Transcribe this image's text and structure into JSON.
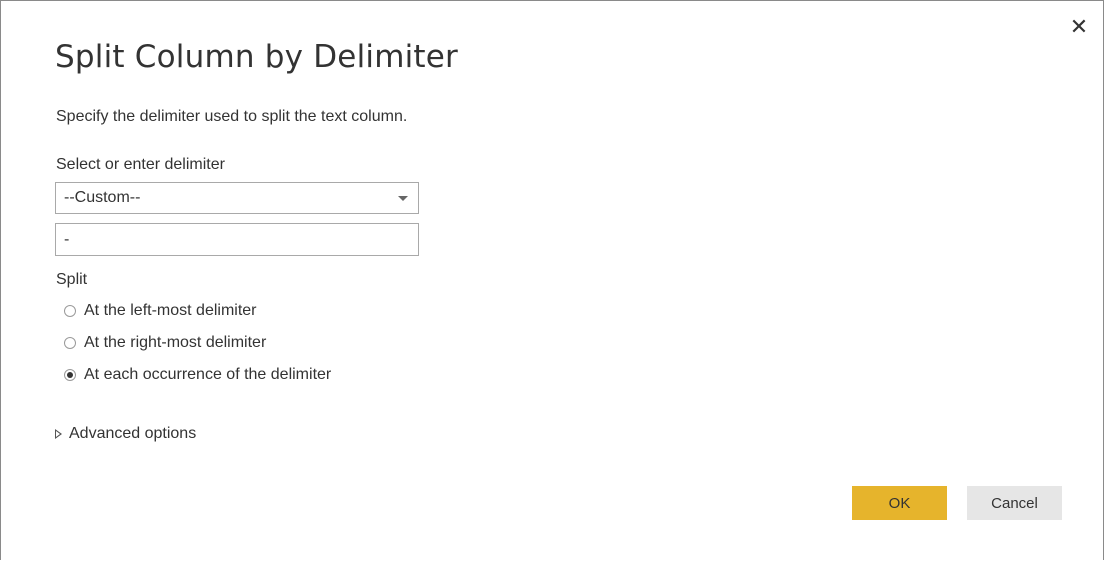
{
  "dialog": {
    "title": "Split Column by Delimiter",
    "description": "Specify the delimiter used to split the text column.",
    "close_glyph": "✕",
    "close_icon": "close-icon"
  },
  "delimiter": {
    "label": "Select or enter delimiter",
    "selected": "--Custom--",
    "custom_value": "-"
  },
  "split": {
    "label": "Split",
    "options": [
      {
        "label": "At the left-most delimiter",
        "checked": false
      },
      {
        "label": "At the right-most delimiter",
        "checked": false
      },
      {
        "label": "At each occurrence of the delimiter",
        "checked": true
      }
    ]
  },
  "advanced": {
    "label": "Advanced options"
  },
  "buttons": {
    "ok": "OK",
    "cancel": "Cancel"
  },
  "colors": {
    "ok_button": "#e6b42c",
    "cancel_button": "#e6e6e6",
    "text": "#333333"
  }
}
